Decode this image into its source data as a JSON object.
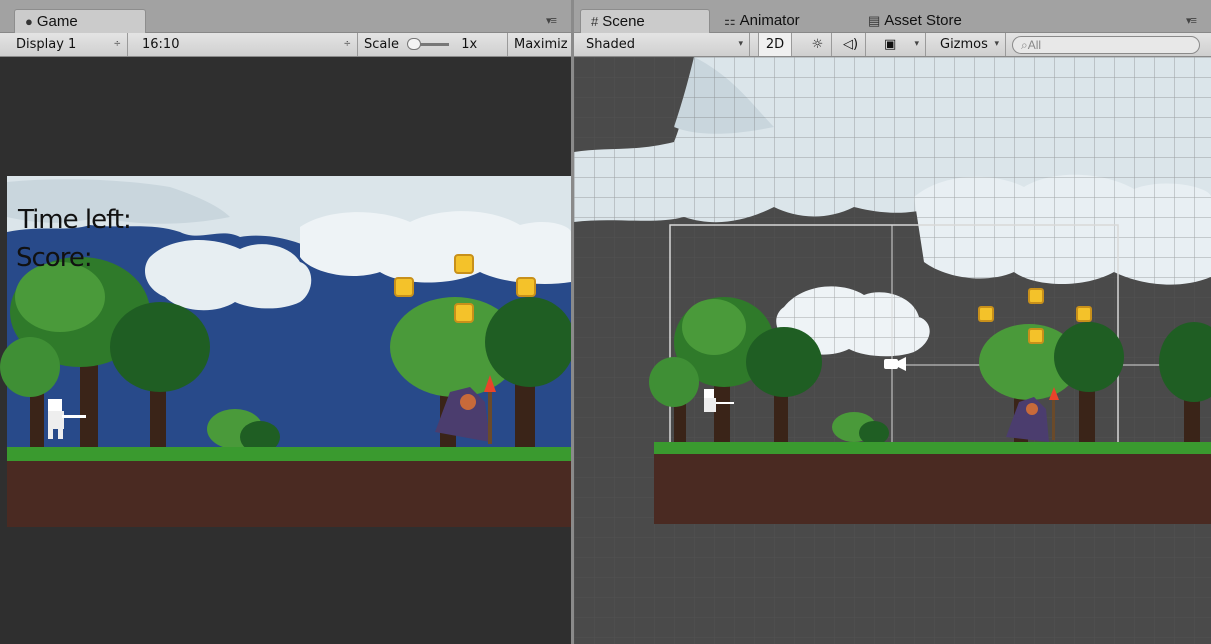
{
  "game_window": {
    "tab_label": "Game",
    "toolbar": {
      "display": "Display 1",
      "aspect": "16:10",
      "scale_label": "Scale",
      "scale_value": "1x",
      "maximize": "Maximiz"
    },
    "hud": {
      "time_left": "Time left:",
      "score": "Score:"
    }
  },
  "scene_window": {
    "tabs": [
      {
        "label": "Scene",
        "icon": "grid-icon"
      },
      {
        "label": "Animator",
        "icon": "animator-icon"
      },
      {
        "label": "Asset Store",
        "icon": "store-icon"
      }
    ],
    "toolbar": {
      "shading": "Shaded",
      "mode_2d": "2D",
      "gizmos": "Gizmos",
      "search_placeholder": "All"
    }
  },
  "colors": {
    "sky": "#284a8a",
    "ground_grass": "#3a9a2f",
    "ground_dirt": "#4a2a22",
    "coin": "#f4c22a",
    "panel": "#c2c2c2"
  }
}
